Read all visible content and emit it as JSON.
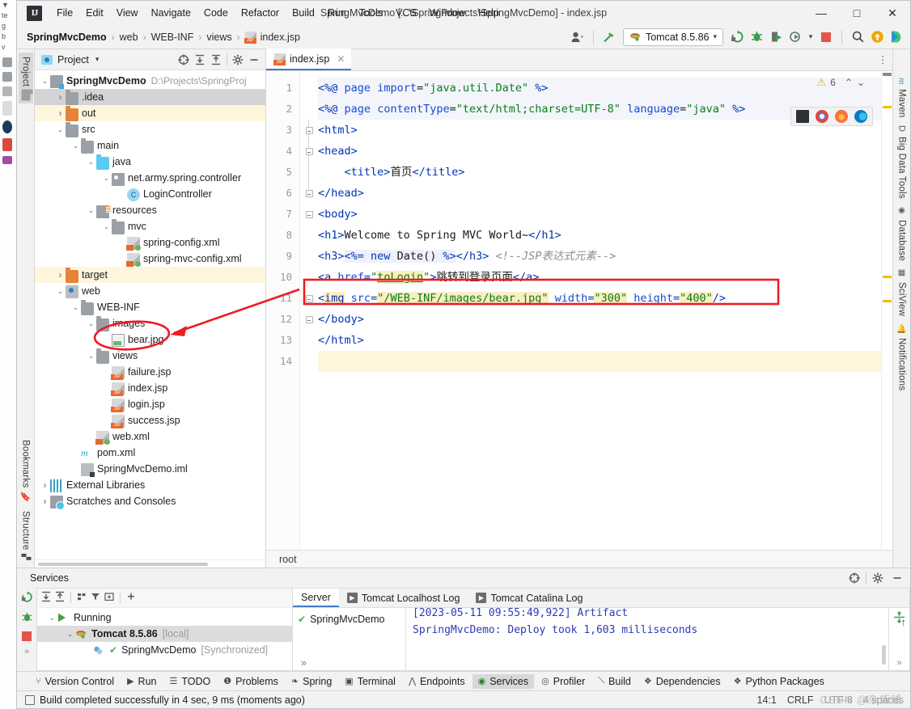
{
  "window": {
    "title": "SpringMvcDemo [...\\SpringProjects\\SpringMvcDemo] - index.jsp",
    "minimize": "—",
    "maximize": "□",
    "close": "✕"
  },
  "menu": {
    "logo": "IJ",
    "items": [
      "File",
      "Edit",
      "View",
      "Navigate",
      "Code",
      "Refactor",
      "Build",
      "Run",
      "Tools",
      "VCS",
      "Window",
      "Help"
    ]
  },
  "navbar": {
    "breadcrumbs": [
      "SpringMvcDemo",
      "web",
      "WEB-INF",
      "views",
      "index.jsp"
    ],
    "separator": "›",
    "run_config": "Tomcat 8.5.86",
    "dropdown_caret": "▾"
  },
  "left_strip": {
    "project_label": "Project",
    "bookmarks_label": "Bookmarks",
    "structure_label": "Structure"
  },
  "right_strip": {
    "items": [
      "Maven",
      "Big Data Tools",
      "Database",
      "SciView",
      "Notifications"
    ]
  },
  "project_panel": {
    "title": "Project",
    "caret": "▾",
    "tree": [
      {
        "indent": 0,
        "arrow": "v",
        "icon": "module-icon",
        "label": "SpringMvcDemo",
        "sub": "D:\\Projects\\SpringProj",
        "bold": true,
        "state": "none"
      },
      {
        "indent": 1,
        "arrow": ">",
        "icon": "folder-icon",
        "label": ".idea",
        "sub": "",
        "bold": false,
        "state": "selected"
      },
      {
        "indent": 1,
        "arrow": ">",
        "icon": "folder-orange-icon",
        "label": "out",
        "sub": "",
        "bold": false,
        "state": "highlight"
      },
      {
        "indent": 1,
        "arrow": "v",
        "icon": "folder-icon",
        "label": "src",
        "sub": "",
        "bold": false,
        "state": "none"
      },
      {
        "indent": 2,
        "arrow": "v",
        "icon": "folder-icon",
        "label": "main",
        "sub": "",
        "bold": false,
        "state": "none"
      },
      {
        "indent": 3,
        "arrow": "v",
        "icon": "folder-blue-icon",
        "label": "java",
        "sub": "",
        "bold": false,
        "state": "none"
      },
      {
        "indent": 4,
        "arrow": "v",
        "icon": "package-icon",
        "label": "net.army.spring.controller",
        "sub": "",
        "bold": false,
        "state": "none"
      },
      {
        "indent": 5,
        "arrow": "",
        "icon": "class-icon",
        "label": "LoginController",
        "sub": "",
        "bold": false,
        "state": "none"
      },
      {
        "indent": 3,
        "arrow": "v",
        "icon": "resources-icon",
        "label": "resources",
        "sub": "",
        "bold": false,
        "state": "none"
      },
      {
        "indent": 4,
        "arrow": "v",
        "icon": "folder-icon",
        "label": "mvc",
        "sub": "",
        "bold": false,
        "state": "none"
      },
      {
        "indent": 5,
        "arrow": "",
        "icon": "xml-icon",
        "label": "spring-config.xml",
        "sub": "",
        "bold": false,
        "state": "none"
      },
      {
        "indent": 5,
        "arrow": "",
        "icon": "xml-icon",
        "label": "spring-mvc-config.xml",
        "sub": "",
        "bold": false,
        "state": "none"
      },
      {
        "indent": 1,
        "arrow": ">",
        "icon": "folder-orange-icon",
        "label": "target",
        "sub": "",
        "bold": false,
        "state": "highlight"
      },
      {
        "indent": 1,
        "arrow": "v",
        "icon": "web-icon",
        "label": "web",
        "sub": "",
        "bold": false,
        "state": "none"
      },
      {
        "indent": 2,
        "arrow": "v",
        "icon": "folder-icon",
        "label": "WEB-INF",
        "sub": "",
        "bold": false,
        "state": "none"
      },
      {
        "indent": 3,
        "arrow": "v",
        "icon": "folder-icon",
        "label": "images",
        "sub": "",
        "bold": false,
        "state": "none"
      },
      {
        "indent": 4,
        "arrow": "",
        "icon": "image-icon",
        "label": "bear.jpg",
        "sub": "",
        "bold": false,
        "state": "none"
      },
      {
        "indent": 3,
        "arrow": "v",
        "icon": "folder-icon",
        "label": "views",
        "sub": "",
        "bold": false,
        "state": "none"
      },
      {
        "indent": 4,
        "arrow": "",
        "icon": "jsp-icon",
        "label": "failure.jsp",
        "sub": "",
        "bold": false,
        "state": "none"
      },
      {
        "indent": 4,
        "arrow": "",
        "icon": "jsp-icon",
        "label": "index.jsp",
        "sub": "",
        "bold": false,
        "state": "none"
      },
      {
        "indent": 4,
        "arrow": "",
        "icon": "jsp-icon",
        "label": "login.jsp",
        "sub": "",
        "bold": false,
        "state": "none"
      },
      {
        "indent": 4,
        "arrow": "",
        "icon": "jsp-icon",
        "label": "success.jsp",
        "sub": "",
        "bold": false,
        "state": "none"
      },
      {
        "indent": 3,
        "arrow": "",
        "icon": "xml-icon",
        "label": "web.xml",
        "sub": "",
        "bold": false,
        "state": "none"
      },
      {
        "indent": 2,
        "arrow": "",
        "icon": "maven-icon",
        "label": "pom.xml",
        "sub": "",
        "bold": false,
        "state": "none"
      },
      {
        "indent": 2,
        "arrow": "",
        "icon": "iml-icon",
        "label": "SpringMvcDemo.iml",
        "sub": "",
        "bold": false,
        "state": "none"
      },
      {
        "indent": 0,
        "arrow": ">",
        "icon": "library-icon",
        "label": "External Libraries",
        "sub": "",
        "bold": false,
        "state": "none"
      },
      {
        "indent": 0,
        "arrow": ">",
        "icon": "scratches-icon",
        "label": "Scratches and Consoles",
        "sub": "",
        "bold": false,
        "state": "none"
      }
    ]
  },
  "editor": {
    "tab_label": "index.jsp",
    "tab_close": "✕",
    "kebab": "⋮",
    "inspection_count": "6",
    "warning_glyph": "⚠",
    "chevron_up": "⌃",
    "chevron_down": "⌄",
    "breadcrumb": "root",
    "line_numbers": [
      "1",
      "2",
      "3",
      "4",
      "5",
      "6",
      "7",
      "8",
      "9",
      "10",
      "11",
      "12",
      "13",
      "14"
    ],
    "lines": [
      "<%@ page import=\"java.util.Date\" %>",
      "<%@ page contentType=\"text/html;charset=UTF-8\" language=\"java\" %>",
      "<html>",
      "<head>",
      "    <title>首页</title>",
      "</head>",
      "<body>",
      "<h1>Welcome to Spring MVC World~</h1>",
      "<h3><%= new Date() %></h3> <!--JSP表达式元素-->",
      "<a href=\"toLogin\">跳转到登录页面</a>",
      "<img src=\"/WEB-INF/images/bear.jpg\" width=\"300\" height=\"400\"/>",
      "</body>",
      "</html>",
      ""
    ]
  },
  "services": {
    "title": "Services",
    "tree": [
      {
        "indent": 0,
        "arrow": "v",
        "icon": "run-icon",
        "label": "Running",
        "sub": "",
        "bold": false,
        "sel": false
      },
      {
        "indent": 1,
        "arrow": "v",
        "icon": "tomcat-icon",
        "label": "Tomcat 8.5.86",
        "sub": "[local]",
        "bold": true,
        "sel": true
      },
      {
        "indent": 2,
        "arrow": "",
        "icon": "artifact-icon",
        "label": "SpringMvcDemo",
        "sub": "[Synchronized]",
        "bold": false,
        "sel": false
      }
    ],
    "tabs": [
      {
        "label": "Server",
        "selected": true,
        "icon": ""
      },
      {
        "label": "Tomcat Localhost Log",
        "selected": false,
        "icon": "console-icon"
      },
      {
        "label": "Tomcat Catalina Log",
        "selected": false,
        "icon": "console-icon"
      }
    ],
    "server_item": "SpringMvcDemo",
    "log_line_1": "[2023-05-11 09:55:49,922] Artifact",
    "log_line_2": "SpringMvcDemo: Deploy took 1,603 milliseconds",
    "more": "»",
    "scroll_up": "↑"
  },
  "tool_window_bar": {
    "items": [
      {
        "label": "Version Control",
        "icon": "branch-icon",
        "selected": false
      },
      {
        "label": "Run",
        "icon": "play-icon",
        "selected": false
      },
      {
        "label": "TODO",
        "icon": "list-icon",
        "selected": false
      },
      {
        "label": "Problems",
        "icon": "error-icon",
        "selected": false
      },
      {
        "label": "Spring",
        "icon": "leaf-icon",
        "selected": false
      },
      {
        "label": "Terminal",
        "icon": "terminal-icon",
        "selected": false
      },
      {
        "label": "Endpoints",
        "icon": "endpoints-icon",
        "selected": false
      },
      {
        "label": "Services",
        "icon": "services-icon",
        "selected": true
      },
      {
        "label": "Profiler",
        "icon": "profiler-icon",
        "selected": false
      },
      {
        "label": "Build",
        "icon": "hammer-icon",
        "selected": false
      },
      {
        "label": "Dependencies",
        "icon": "stack-icon",
        "selected": false
      },
      {
        "label": "Python Packages",
        "icon": "stack-icon",
        "selected": false
      }
    ]
  },
  "status_bar": {
    "message": "Build completed successfully in 4 sec, 9 ms (moments ago)",
    "caret": "14:1",
    "line_sep": "CRLF",
    "encoding": "UTF-8",
    "indent": "4 spaces",
    "watermark": "CSDN @杂货铺"
  },
  "colors": {
    "accent_blue": "#3e7ecb",
    "string_green": "#067d17",
    "tag_blue": "#0033b3",
    "warning_yellow": "#f0c000",
    "annotation_red": "#ee1b24",
    "folder_orange": "#e8833a",
    "run_green": "#43a047"
  }
}
